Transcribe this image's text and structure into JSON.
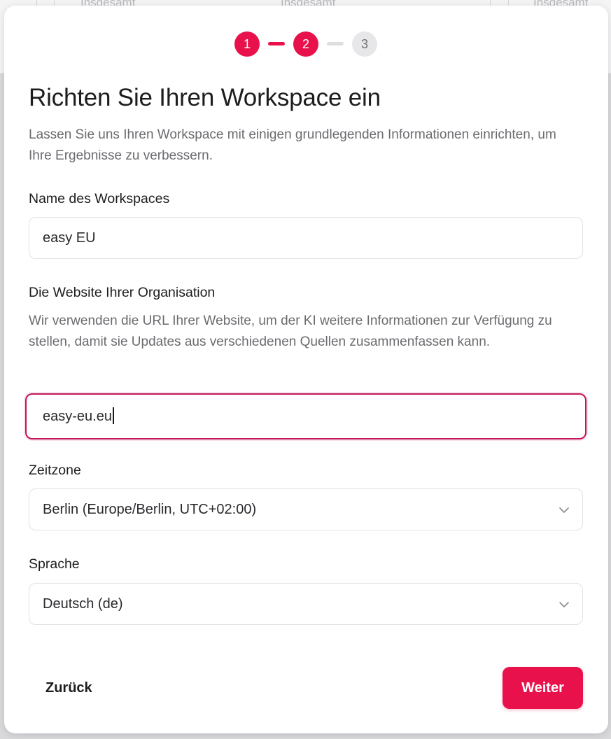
{
  "background": {
    "columns": [
      "Insgesamt",
      "Insgesamt",
      "Insgesamt"
    ]
  },
  "stepper": {
    "steps": [
      {
        "label": "1",
        "state": "active"
      },
      {
        "label": "2",
        "state": "active"
      },
      {
        "label": "3",
        "state": "pending"
      }
    ]
  },
  "dialog": {
    "title": "Richten Sie Ihren Workspace ein",
    "subtitle": "Lassen Sie uns Ihren Workspace mit einigen grundlegenden Informationen einrichten, um Ihre Ergebnisse zu verbessern."
  },
  "form": {
    "workspace_name": {
      "label": "Name des Workspaces",
      "value": "easy EU"
    },
    "website": {
      "label": "Die Website Ihrer Organisation",
      "help": "Wir verwenden die URL Ihrer Website, um der KI weitere Informationen zur Verfügung zu stellen, damit sie Updates aus verschiedenen Quellen zusammenfassen kann.",
      "value": "easy-eu.eu"
    },
    "timezone": {
      "label": "Zeitzone",
      "value": "Berlin (Europe/Berlin, UTC+02:00)"
    },
    "language": {
      "label": "Sprache",
      "value": "Deutsch (de)"
    }
  },
  "actions": {
    "back_label": "Zurück",
    "next_label": "Weiter"
  },
  "colors": {
    "accent": "#e8114b",
    "focus_border": "#c2185b",
    "pending_step": "#e7e7e9"
  },
  "icons": {
    "select_chevron": "chevron-down-icon"
  }
}
